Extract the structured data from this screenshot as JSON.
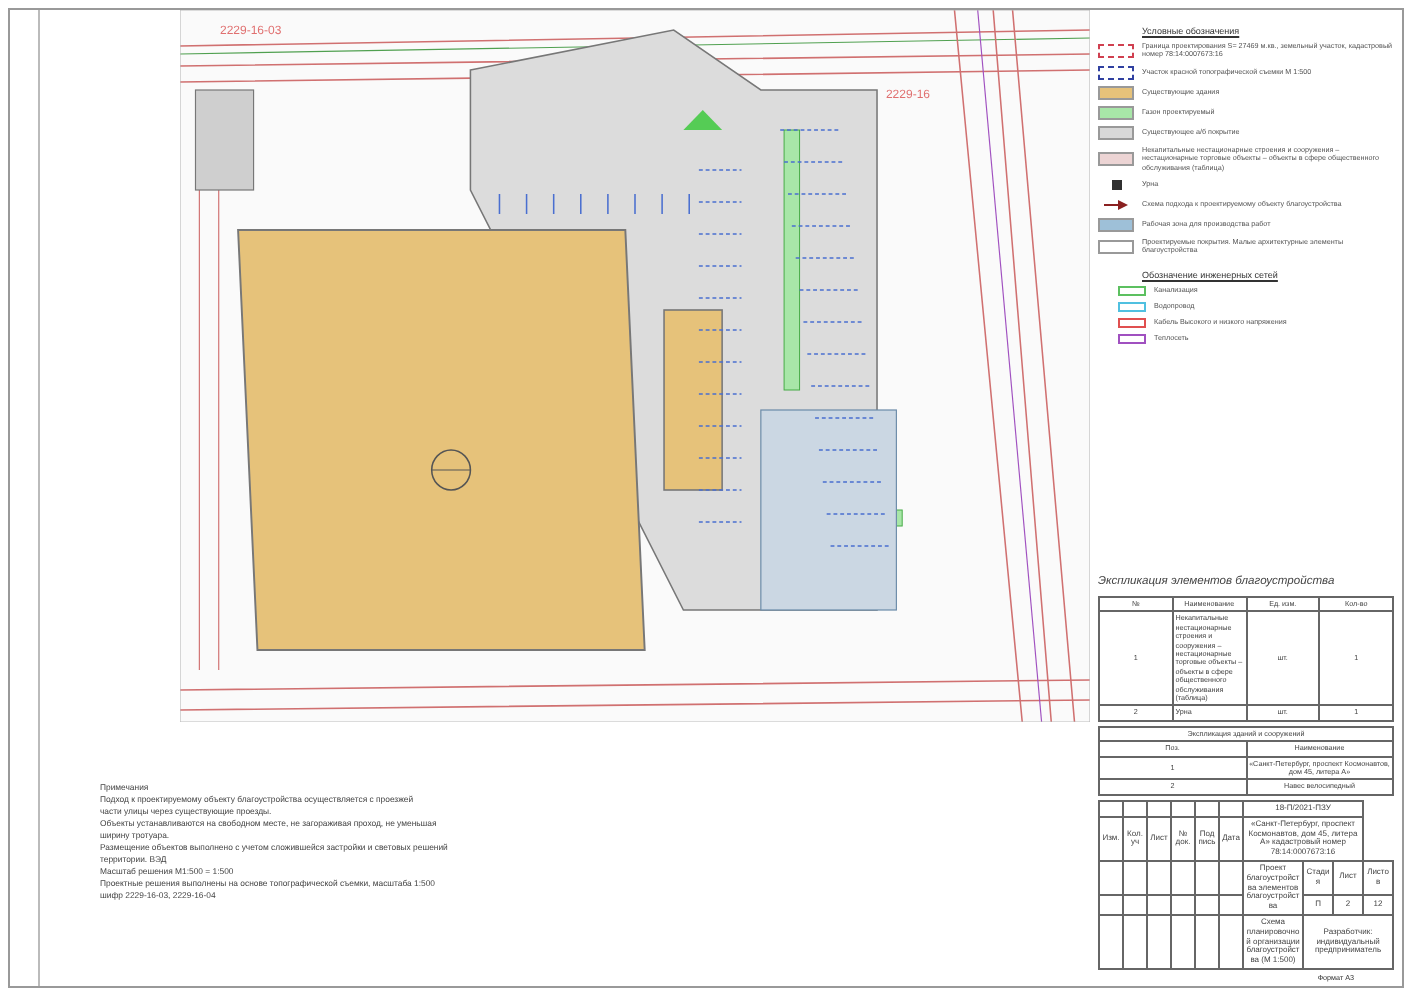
{
  "sheet_labels": [
    {
      "text": "2229-16-03"
    },
    {
      "text": "2229-16"
    }
  ],
  "legend": {
    "title": "Условные обозначения",
    "items": [
      {
        "kind": "outline",
        "color": "#d04050",
        "label": "Граница проектирования S= 27469 м.кв., земельный участок, кадастровый номер 78:14:0007673:16"
      },
      {
        "kind": "outline",
        "color": "#3040a0",
        "label": "Участок красной топографической съемки М 1:500"
      },
      {
        "kind": "area",
        "color": "#e6c27a",
        "label": "Существующие здания"
      },
      {
        "kind": "area",
        "color": "#a8e6a8",
        "label": "Газон проектируемый"
      },
      {
        "kind": "area",
        "color": "#d8d8d8",
        "label": "Существующее а/б покрытие"
      },
      {
        "kind": "area",
        "color": "#ecd4d4",
        "label": "Некапитальные нестационарные строения и сооружения – нестационарные торговые объекты – объекты в сфере общественного обслуживания (таблица)"
      },
      {
        "kind": "marker",
        "color": "#303030",
        "label": "Урна"
      },
      {
        "kind": "arrow",
        "color": "#8a2020",
        "label": "Схема подхода к проектируемому объекту благоустройства"
      },
      {
        "kind": "area",
        "color": "#9ec0d8",
        "label": "Рабочая зона для производства работ"
      },
      {
        "kind": "area",
        "color": "#ffffff",
        "label": "Проектируемые покрытия. Малые архитектурные элементы благоустройства"
      }
    ]
  },
  "networks": {
    "title": "Обозначение инженерных сетей",
    "items": [
      {
        "color": "#5cc060",
        "label": "Канализация"
      },
      {
        "color": "#50c0e0",
        "label": "Водопровод"
      },
      {
        "color": "#e05050",
        "label": "Кабель Высокого и низкого напряжения"
      },
      {
        "color": "#a050c0",
        "label": "Теплосеть"
      }
    ]
  },
  "notes": {
    "title": "Примечания",
    "lines": [
      "Подход к проектируемому объекту благоустройства осуществляется с проезжей",
      "части улицы через существующие проезды.",
      "Объекты устанавливаются на свободном месте, не загораживая проход, не уменьшая",
      "ширину тротуара.",
      "Размещение объектов выполнено с учетом сложившейся застройки и световых решений",
      "территории. ВЭД",
      "Масштаб решения М1:500 = 1:500",
      "Проектные решения выполнены на основе топографической съемки, масштаба 1:500",
      "шифр 2229-16-03, 2229-16-04"
    ]
  },
  "explication": {
    "title": "Экспликация элементов благоустройства",
    "columns": [
      "№",
      "Наименование",
      "Ед. изм.",
      "Кол-во"
    ],
    "rows": [
      [
        "1",
        "Некапитальные нестационарные строения и сооружения – нестационарные торговые объекты – объекты в сфере общественного обслуживания (таблица)",
        "шт.",
        "1"
      ],
      [
        "2",
        "Урна",
        "шт.",
        "1"
      ]
    ]
  },
  "buildings": {
    "title": "Экспликация зданий и сооружений",
    "columns": [
      "Поз.",
      "Наименование"
    ],
    "rows": [
      [
        "1",
        "«Санкт-Петербург, проспект Космонавтов, дом 45, литера А»"
      ],
      [
        "2",
        "Навес велосипедный"
      ]
    ]
  },
  "title_block": {
    "signature_headers": [
      "Изм.",
      "Кол.уч",
      "Лист",
      "№ док.",
      "Подпись",
      "Дата"
    ],
    "code": "18-П/2021-ПЗУ",
    "address": "«Санкт-Петербург, проспект Космонавтов, дом 45, литера А» кадастровый номер 78:14:0007673:16",
    "project": "Проект благоустройства элементов благоустройства",
    "stage_headers": [
      "Стадия",
      "Лист",
      "Листов"
    ],
    "stage_values": [
      "П",
      "2",
      "12"
    ],
    "sheet_name": "Схема планировочной организации благоустройства (М 1:500)",
    "org": "Разработчик: индивидуальный предприниматель"
  },
  "format": "Формат А3"
}
